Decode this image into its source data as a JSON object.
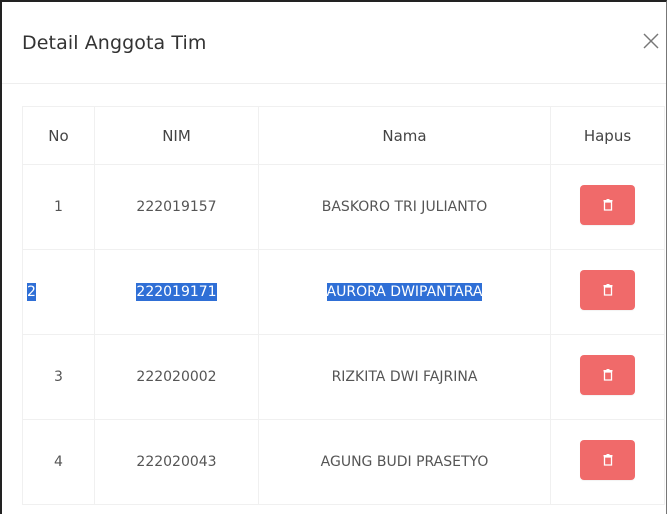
{
  "modal": {
    "title": "Detail Anggota Tim",
    "close_icon": "close-icon"
  },
  "table": {
    "headers": [
      "No",
      "NIM",
      "Nama",
      "Hapus"
    ],
    "rows": [
      {
        "no": "1",
        "nim": "222019157",
        "nama": "BASKORO TRI JULIANTO",
        "selected": false
      },
      {
        "no": "2",
        "nim": "222019171",
        "nama": "AURORA DWIPANTARA",
        "selected": true
      },
      {
        "no": "3",
        "nim": "222020002",
        "nama": "RIZKITA DWI FAJRINA",
        "selected": false
      },
      {
        "no": "4",
        "nim": "222020043",
        "nama": "AGUNG BUDI PRASETYO",
        "selected": false
      }
    ],
    "delete_icon": "trash-icon"
  },
  "colors": {
    "delete_button": "#f06a6a",
    "selection": "#2f6fd6"
  }
}
